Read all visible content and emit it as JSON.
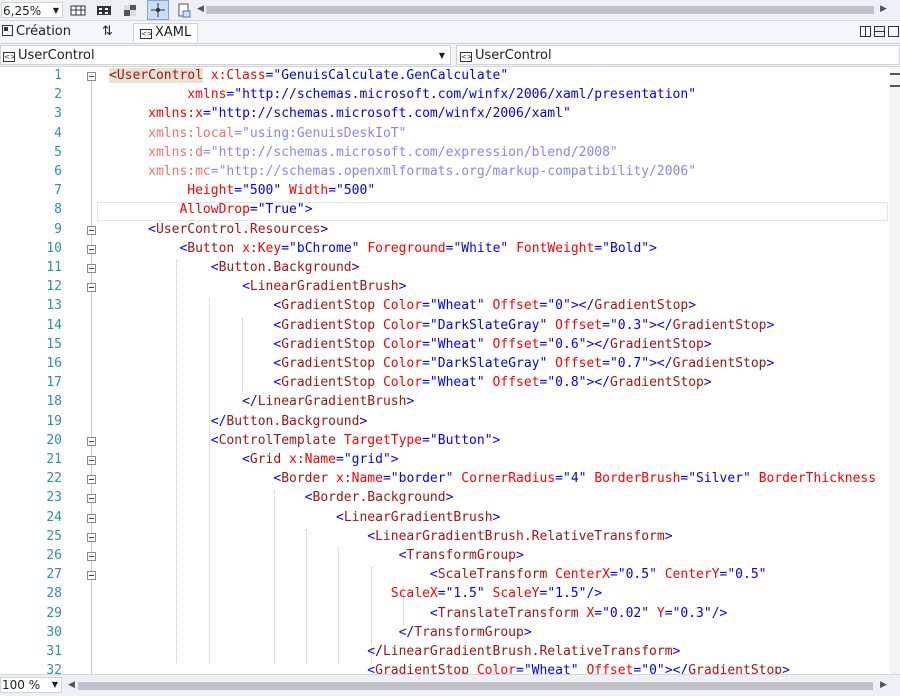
{
  "toolbar": {
    "zoom": "6,25%"
  },
  "tabs": [
    {
      "label": "Création"
    },
    {
      "label": "XAML"
    }
  ],
  "nav": {
    "left": "UserControl",
    "right": "UserControl"
  },
  "status": {
    "zoom": "100 %"
  },
  "lines": [
    {
      "n": "1",
      "segs": [
        [
          "n",
          "<UserControl"
        ],
        [
          "t",
          " "
        ],
        [
          "a",
          "x:Class"
        ],
        [
          "b",
          "="
        ],
        [
          "v",
          "\"GenuisCalculate.GenCalculate\""
        ]
      ]
    },
    {
      "n": "2",
      "segs": [
        [
          "t",
          "          "
        ],
        [
          "a",
          "xmlns"
        ],
        [
          "b",
          "="
        ],
        [
          "v",
          "\"http://schemas.microsoft.com/winfx/2006/xaml/presentation\""
        ]
      ]
    },
    {
      "n": "3",
      "segs": [
        [
          "t",
          "     "
        ],
        [
          "a",
          "xmlns:x"
        ],
        [
          "b",
          "="
        ],
        [
          "v",
          "\"http://schemas.microsoft.com/winfx/2006/xaml\""
        ]
      ]
    },
    {
      "n": "4",
      "segs": [
        [
          "t",
          "     "
        ],
        [
          "d",
          "xmlns:local"
        ],
        [
          "dv",
          "=\"using:GenuisDeskIoT\""
        ]
      ]
    },
    {
      "n": "5",
      "segs": [
        [
          "t",
          "     "
        ],
        [
          "d",
          "xmlns:d"
        ],
        [
          "dv",
          "=\"http://schemas.microsoft.com/expression/blend/2008\""
        ]
      ]
    },
    {
      "n": "6",
      "segs": [
        [
          "t",
          "     "
        ],
        [
          "d",
          "xmlns:mc"
        ],
        [
          "dv",
          "=\"http://schemas.openxmlformats.org/markup-compatibility/2006\""
        ]
      ]
    },
    {
      "n": "7",
      "segs": [
        [
          "t",
          "          "
        ],
        [
          "a",
          "Height"
        ],
        [
          "b",
          "="
        ],
        [
          "v",
          "\"500\""
        ],
        [
          "t",
          " "
        ],
        [
          "a",
          "Width"
        ],
        [
          "b",
          "="
        ],
        [
          "v",
          "\"500\""
        ]
      ]
    },
    {
      "n": "8",
      "segs": [
        [
          "t",
          "         "
        ],
        [
          "a",
          "AllowDrop"
        ],
        [
          "b",
          "="
        ],
        [
          "v",
          "\"True\""
        ],
        [
          "b",
          ">"
        ]
      ]
    },
    {
      "n": "9",
      "segs": [
        [
          "t",
          "     "
        ],
        [
          "b",
          "<"
        ],
        [
          "n",
          "UserControl.Resources"
        ],
        [
          "b",
          ">"
        ]
      ]
    },
    {
      "n": "10",
      "segs": [
        [
          "t",
          "         "
        ],
        [
          "b",
          "<"
        ],
        [
          "n",
          "Button"
        ],
        [
          "t",
          " "
        ],
        [
          "a",
          "x:Key"
        ],
        [
          "b",
          "="
        ],
        [
          "v",
          "\"bChrome\""
        ],
        [
          "t",
          " "
        ],
        [
          "a",
          "Foreground"
        ],
        [
          "b",
          "="
        ],
        [
          "v",
          "\"White\""
        ],
        [
          "t",
          " "
        ],
        [
          "a",
          "FontWeight"
        ],
        [
          "b",
          "="
        ],
        [
          "v",
          "\"Bold\""
        ],
        [
          "b",
          ">"
        ]
      ]
    },
    {
      "n": "11",
      "segs": [
        [
          "t",
          "             "
        ],
        [
          "b",
          "<"
        ],
        [
          "n",
          "Button.Background"
        ],
        [
          "b",
          ">"
        ]
      ]
    },
    {
      "n": "12",
      "segs": [
        [
          "t",
          "                 "
        ],
        [
          "b",
          "<"
        ],
        [
          "n",
          "LinearGradientBrush"
        ],
        [
          "b",
          ">"
        ]
      ]
    },
    {
      "n": "13",
      "segs": [
        [
          "t",
          "                     "
        ],
        [
          "b",
          "<"
        ],
        [
          "n",
          "GradientStop"
        ],
        [
          "t",
          " "
        ],
        [
          "a",
          "Color"
        ],
        [
          "b",
          "="
        ],
        [
          "v",
          "\"Wheat\""
        ],
        [
          "t",
          " "
        ],
        [
          "a",
          "Offset"
        ],
        [
          "b",
          "="
        ],
        [
          "v",
          "\"0\""
        ],
        [
          "b",
          "></"
        ],
        [
          "n",
          "GradientStop"
        ],
        [
          "b",
          ">"
        ]
      ]
    },
    {
      "n": "14",
      "segs": [
        [
          "t",
          "                     "
        ],
        [
          "b",
          "<"
        ],
        [
          "n",
          "GradientStop"
        ],
        [
          "t",
          " "
        ],
        [
          "a",
          "Color"
        ],
        [
          "b",
          "="
        ],
        [
          "v",
          "\"DarkSlateGray\""
        ],
        [
          "t",
          " "
        ],
        [
          "a",
          "Offset"
        ],
        [
          "b",
          "="
        ],
        [
          "v",
          "\"0.3\""
        ],
        [
          "b",
          "></"
        ],
        [
          "n",
          "GradientStop"
        ],
        [
          "b",
          ">"
        ]
      ]
    },
    {
      "n": "15",
      "segs": [
        [
          "t",
          "                     "
        ],
        [
          "b",
          "<"
        ],
        [
          "n",
          "GradientStop"
        ],
        [
          "t",
          " "
        ],
        [
          "a",
          "Color"
        ],
        [
          "b",
          "="
        ],
        [
          "v",
          "\"Wheat\""
        ],
        [
          "t",
          " "
        ],
        [
          "a",
          "Offset"
        ],
        [
          "b",
          "="
        ],
        [
          "v",
          "\"0.6\""
        ],
        [
          "b",
          "></"
        ],
        [
          "n",
          "GradientStop"
        ],
        [
          "b",
          ">"
        ]
      ]
    },
    {
      "n": "16",
      "segs": [
        [
          "t",
          "                     "
        ],
        [
          "b",
          "<"
        ],
        [
          "n",
          "GradientStop"
        ],
        [
          "t",
          " "
        ],
        [
          "a",
          "Color"
        ],
        [
          "b",
          "="
        ],
        [
          "v",
          "\"DarkSlateGray\""
        ],
        [
          "t",
          " "
        ],
        [
          "a",
          "Offset"
        ],
        [
          "b",
          "="
        ],
        [
          "v",
          "\"0.7\""
        ],
        [
          "b",
          "></"
        ],
        [
          "n",
          "GradientStop"
        ],
        [
          "b",
          ">"
        ]
      ]
    },
    {
      "n": "17",
      "segs": [
        [
          "t",
          "                     "
        ],
        [
          "b",
          "<"
        ],
        [
          "n",
          "GradientStop"
        ],
        [
          "t",
          " "
        ],
        [
          "a",
          "Color"
        ],
        [
          "b",
          "="
        ],
        [
          "v",
          "\"Wheat\""
        ],
        [
          "t",
          " "
        ],
        [
          "a",
          "Offset"
        ],
        [
          "b",
          "="
        ],
        [
          "v",
          "\"0.8\""
        ],
        [
          "b",
          "></"
        ],
        [
          "n",
          "GradientStop"
        ],
        [
          "b",
          ">"
        ]
      ]
    },
    {
      "n": "18",
      "segs": [
        [
          "t",
          "                 "
        ],
        [
          "b",
          "</"
        ],
        [
          "n",
          "LinearGradientBrush"
        ],
        [
          "b",
          ">"
        ]
      ]
    },
    {
      "n": "19",
      "segs": [
        [
          "t",
          "             "
        ],
        [
          "b",
          "</"
        ],
        [
          "n",
          "Button.Background"
        ],
        [
          "b",
          ">"
        ]
      ]
    },
    {
      "n": "20",
      "segs": [
        [
          "t",
          "             "
        ],
        [
          "b",
          "<"
        ],
        [
          "n",
          "ControlTemplate"
        ],
        [
          "t",
          " "
        ],
        [
          "a",
          "TargetType"
        ],
        [
          "b",
          "="
        ],
        [
          "v",
          "\"Button\""
        ],
        [
          "b",
          ">"
        ]
      ]
    },
    {
      "n": "21",
      "segs": [
        [
          "t",
          "                 "
        ],
        [
          "b",
          "<"
        ],
        [
          "n",
          "Grid"
        ],
        [
          "t",
          " "
        ],
        [
          "a",
          "x:Name"
        ],
        [
          "b",
          "="
        ],
        [
          "v",
          "\"grid\""
        ],
        [
          "b",
          ">"
        ]
      ]
    },
    {
      "n": "22",
      "segs": [
        [
          "t",
          "                     "
        ],
        [
          "b",
          "<"
        ],
        [
          "n",
          "Border"
        ],
        [
          "t",
          " "
        ],
        [
          "a",
          "x:Name"
        ],
        [
          "b",
          "="
        ],
        [
          "v",
          "\"border\""
        ],
        [
          "t",
          " "
        ],
        [
          "a",
          "CornerRadius"
        ],
        [
          "b",
          "="
        ],
        [
          "v",
          "\"4\""
        ],
        [
          "t",
          " "
        ],
        [
          "a",
          "BorderBrush"
        ],
        [
          "b",
          "="
        ],
        [
          "v",
          "\"Silver\""
        ],
        [
          "t",
          " "
        ],
        [
          "a",
          "BorderThickness"
        ]
      ]
    },
    {
      "n": "23",
      "segs": [
        [
          "t",
          "                         "
        ],
        [
          "b",
          "<"
        ],
        [
          "n",
          "Border.Background"
        ],
        [
          "b",
          ">"
        ]
      ]
    },
    {
      "n": "24",
      "segs": [
        [
          "t",
          "                             "
        ],
        [
          "b",
          "<"
        ],
        [
          "n",
          "LinearGradientBrush"
        ],
        [
          "b",
          ">"
        ]
      ]
    },
    {
      "n": "25",
      "segs": [
        [
          "t",
          "                                 "
        ],
        [
          "b",
          "<"
        ],
        [
          "n",
          "LinearGradientBrush.RelativeTransform"
        ],
        [
          "b",
          ">"
        ]
      ]
    },
    {
      "n": "26",
      "segs": [
        [
          "t",
          "                                     "
        ],
        [
          "b",
          "<"
        ],
        [
          "n",
          "TransformGroup"
        ],
        [
          "b",
          ">"
        ]
      ]
    },
    {
      "n": "27",
      "segs": [
        [
          "t",
          "                                         "
        ],
        [
          "b",
          "<"
        ],
        [
          "n",
          "ScaleTransform"
        ],
        [
          "t",
          " "
        ],
        [
          "a",
          "CenterX"
        ],
        [
          "b",
          "="
        ],
        [
          "v",
          "\"0.5\""
        ],
        [
          "t",
          " "
        ],
        [
          "a",
          "CenterY"
        ],
        [
          "b",
          "="
        ],
        [
          "v",
          "\"0.5\""
        ]
      ]
    },
    {
      "n": "28",
      "segs": [
        [
          "t",
          "                                    "
        ],
        [
          "a",
          "ScaleX"
        ],
        [
          "b",
          "="
        ],
        [
          "v",
          "\"1.5\""
        ],
        [
          "t",
          " "
        ],
        [
          "a",
          "ScaleY"
        ],
        [
          "b",
          "="
        ],
        [
          "v",
          "\"1.5\""
        ],
        [
          "b",
          "/>"
        ]
      ]
    },
    {
      "n": "29",
      "segs": [
        [
          "t",
          "                                         "
        ],
        [
          "b",
          "<"
        ],
        [
          "n",
          "TranslateTransform"
        ],
        [
          "t",
          " "
        ],
        [
          "a",
          "X"
        ],
        [
          "b",
          "="
        ],
        [
          "v",
          "\"0.02\""
        ],
        [
          "t",
          " "
        ],
        [
          "a",
          "Y"
        ],
        [
          "b",
          "="
        ],
        [
          "v",
          "\"0.3\""
        ],
        [
          "b",
          "/>"
        ]
      ]
    },
    {
      "n": "30",
      "segs": [
        [
          "t",
          "                                     "
        ],
        [
          "b",
          "</"
        ],
        [
          "n",
          "TransformGroup"
        ],
        [
          "b",
          ">"
        ]
      ]
    },
    {
      "n": "31",
      "segs": [
        [
          "t",
          "                                 "
        ],
        [
          "b",
          "</"
        ],
        [
          "n",
          "LinearGradientBrush.RelativeTransform"
        ],
        [
          "b",
          ">"
        ]
      ]
    },
    {
      "n": "32",
      "segs": [
        [
          "t",
          "                                 "
        ],
        [
          "b",
          "<"
        ],
        [
          "n",
          "GradientStop"
        ],
        [
          "t",
          " "
        ],
        [
          "a",
          "Color"
        ],
        [
          "b",
          "="
        ],
        [
          "v",
          "\"Wheat\""
        ],
        [
          "t",
          " "
        ],
        [
          "a",
          "Offset"
        ],
        [
          "b",
          "="
        ],
        [
          "v",
          "\"0\""
        ],
        [
          "b",
          "></"
        ],
        [
          "n",
          "GradientStop"
        ],
        [
          "b",
          ">"
        ]
      ]
    }
  ]
}
